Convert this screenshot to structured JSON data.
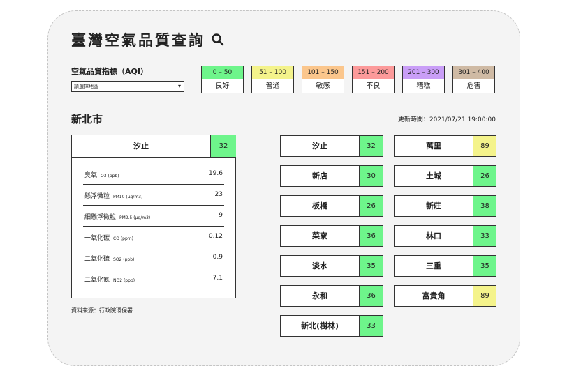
{
  "header": {
    "title": "臺灣空氣品質查詢"
  },
  "aqi": {
    "label": "空氣品質指標（AQI）"
  },
  "region_select": {
    "value": "請選擇地區"
  },
  "legend": [
    {
      "range": "0 – 50",
      "desc": "良好",
      "color": "#6ef58b"
    },
    {
      "range": "51 – 100",
      "desc": "普通",
      "color": "#f4f38b"
    },
    {
      "range": "101 – 150",
      "desc": "敏感",
      "color": "#fbc68c"
    },
    {
      "range": "151 – 200",
      "desc": "不良",
      "color": "#fc9a9a"
    },
    {
      "range": "201 – 300",
      "desc": "糟糕",
      "color": "#c99ef7"
    },
    {
      "range": "301 – 400",
      "desc": "危害",
      "color": "#cfbaa4"
    }
  ],
  "city": "新北市",
  "updated": "更新時間：2021/07/21 19:00:00",
  "detail": {
    "name": "汐止",
    "aqi": "32",
    "pollutants": [
      {
        "name": "臭氧",
        "sub": "O3 (ppb)",
        "value": "19.6"
      },
      {
        "name": "懸浮微粒",
        "sub": "PM10 (μg/m3)",
        "value": "23"
      },
      {
        "name": "細懸浮微粒",
        "sub": "PM2.5 (μg/m3)",
        "value": "9"
      },
      {
        "name": "一氧化碳",
        "sub": "CO (ppm)",
        "value": "0.12"
      },
      {
        "name": "二氧化硫",
        "sub": "SO2 (ppb)",
        "value": "0.9"
      },
      {
        "name": "二氧化氮",
        "sub": "NO2 (ppb)",
        "value": "7.1"
      }
    ]
  },
  "source": "資料來源：行政院環保署",
  "sites": [
    {
      "name": "汐止",
      "aqi": "32",
      "color": "#6ef58b"
    },
    {
      "name": "萬里",
      "aqi": "89",
      "color": "#f4f38b"
    },
    {
      "name": "新店",
      "aqi": "30",
      "color": "#6ef58b"
    },
    {
      "name": "土城",
      "aqi": "26",
      "color": "#6ef58b"
    },
    {
      "name": "板橋",
      "aqi": "26",
      "color": "#6ef58b"
    },
    {
      "name": "新莊",
      "aqi": "38",
      "color": "#6ef58b"
    },
    {
      "name": "菜寮",
      "aqi": "36",
      "color": "#6ef58b"
    },
    {
      "name": "林口",
      "aqi": "33",
      "color": "#6ef58b"
    },
    {
      "name": "淡水",
      "aqi": "35",
      "color": "#6ef58b"
    },
    {
      "name": "三重",
      "aqi": "35",
      "color": "#6ef58b"
    },
    {
      "name": "永和",
      "aqi": "36",
      "color": "#6ef58b"
    },
    {
      "name": "富貴角",
      "aqi": "89",
      "color": "#f4f38b"
    },
    {
      "name": "新北(樹林)",
      "aqi": "33",
      "color": "#6ef58b"
    }
  ]
}
